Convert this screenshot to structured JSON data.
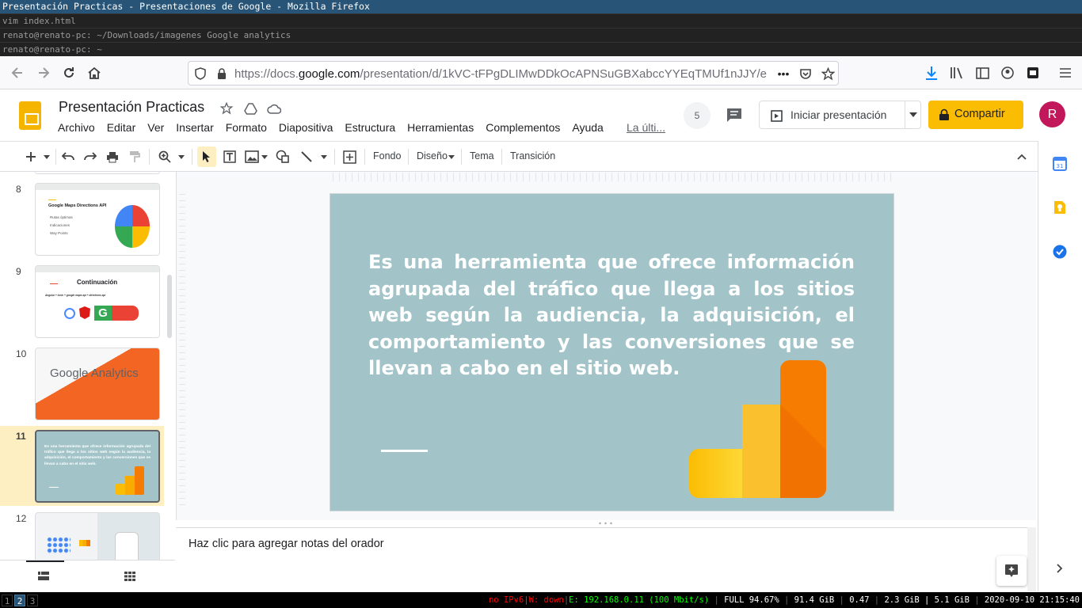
{
  "window": {
    "title": "Presentación Practicas - Presentaciones de Google - Mozilla Firefox",
    "terminals": [
      "vim index.html",
      "renato@renato-pc: ~/Downloads/imagenes Google analytics",
      "renato@renato-pc: ~"
    ]
  },
  "browser": {
    "url_prefix": "https://docs.",
    "url_domain": "google.com",
    "url_rest": "/presentation/d/1kVC-tFPgDLIMwDDkOcAPNSuGBXabccYYEqTMUf1nJJY/e",
    "more": "•••"
  },
  "app": {
    "doc_title": "Presentación Practicas",
    "menus": [
      "Archivo",
      "Editar",
      "Ver",
      "Insertar",
      "Formato",
      "Diapositiva",
      "Estructura",
      "Herramientas",
      "Complementos",
      "Ayuda"
    ],
    "last_edit": "La últi...",
    "comment_count": "5",
    "present_label": "Iniciar presentación",
    "share_label": "Compartir",
    "avatar_letter": "R"
  },
  "toolbar": {
    "background": "Fondo",
    "layout": "Diseño",
    "theme": "Tema",
    "transition": "Transición"
  },
  "filmstrip": {
    "slides": [
      {
        "num": "8",
        "title": "Google Maps Directions API",
        "bullets": [
          "Rutas óptimas",
          "Indicaciones",
          "Way Points"
        ]
      },
      {
        "num": "9",
        "title": "Continuación",
        "subtitle": "Angular + ionic + google maps api + directions api"
      },
      {
        "num": "10",
        "title": "Google Analytics"
      },
      {
        "num": "11",
        "text": "Es una herramienta que ofrece información agrupada del tráfico que llega a los sitios web según la audiencia, la adquisición, el comportamiento y las conversiones que se llevan a cabo en el sitio web."
      },
      {
        "num": "12"
      }
    ]
  },
  "slide": {
    "text": "Es una herramienta que ofrece información agrupada del tráfico que llega a los sitios web según la audiencia, la adquisición, el comportamiento y las conversiones que se llevan a cabo en el sitio web.",
    "background": "#a2c4c9"
  },
  "notes": {
    "placeholder": "Haz clic para agregar notas del orador"
  },
  "statusbar": {
    "workspaces": [
      "1",
      "2",
      "3"
    ],
    "ipv6": "no IPv6",
    "wifi": "W: down",
    "eth": "E: 192.168.0.11 (100 Mbit/s)",
    "battery": "FULL 94.67%",
    "disk": "91.4 GiB",
    "load": "0.47",
    "mem": "2.3 GiB | 5.1 GiB",
    "clock": "2020-09-10 21:15:40"
  },
  "colors": {
    "share": "#fbbc04",
    "accent": "#1a73e8",
    "selected_thumb": "#feefc3"
  }
}
